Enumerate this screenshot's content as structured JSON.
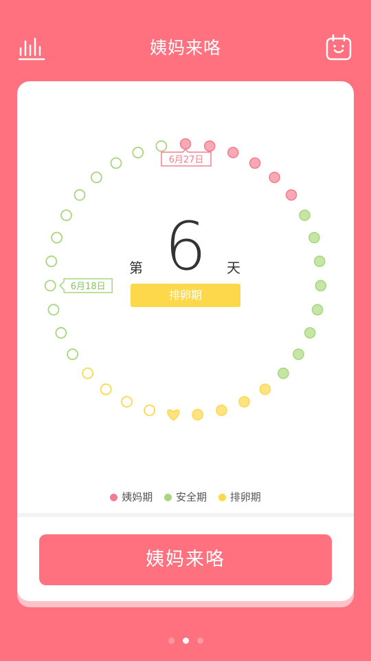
{
  "header": {
    "title": "姨妈来咯",
    "left_icon": "stats-icon",
    "right_icon": "calendar-icon"
  },
  "cycle": {
    "day_prefix": "第",
    "day_number": "6",
    "day_suffix": "天",
    "phase": "排卵期",
    "period_start_label": "6月27日",
    "safe_start_label": "6月18日",
    "total_days": 35,
    "ovulation_day_index": 14
  },
  "colors": {
    "period": "#f47e8e",
    "safe": "#a8d67e",
    "ovulation": "#fdd84a",
    "background": "#ff717f"
  },
  "legend": [
    {
      "label": "姨妈期",
      "color": "#f47e8e"
    },
    {
      "label": "安全期",
      "color": "#a8d67e"
    },
    {
      "label": "排卵期",
      "color": "#fdd84a"
    }
  ],
  "action": {
    "button_label": "姨妈来咯"
  },
  "pager": {
    "count": 3,
    "active_index": 1
  }
}
